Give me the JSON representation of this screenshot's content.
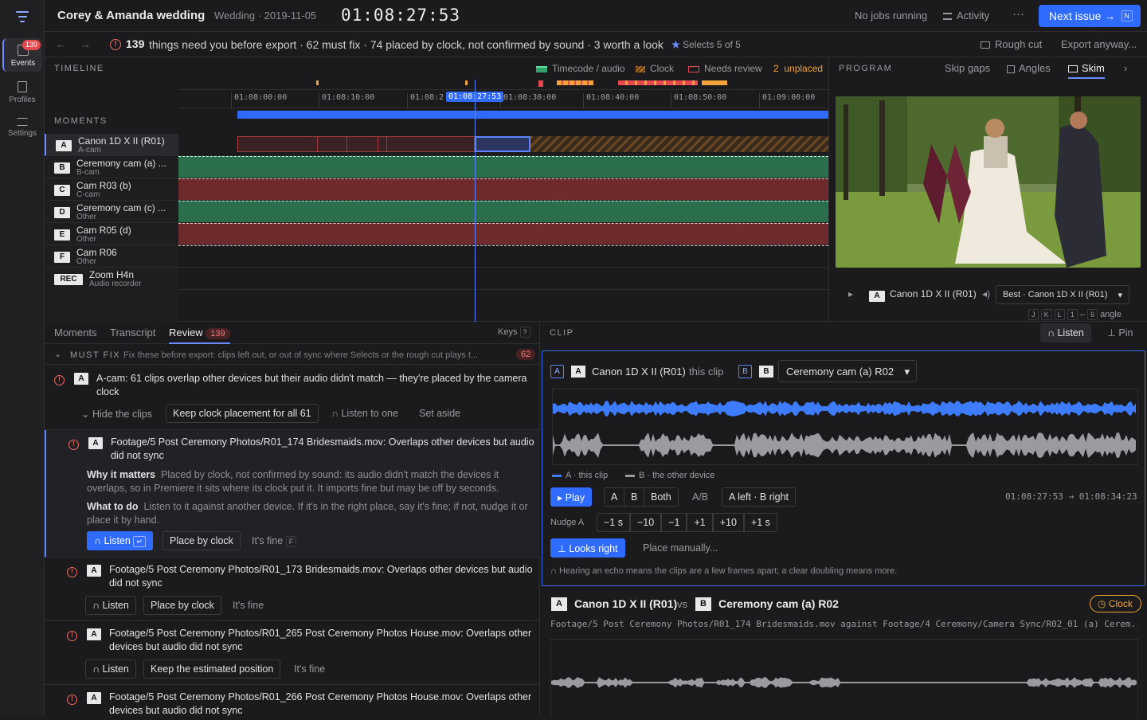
{
  "app": {
    "title": "Corey & Amanda wedding",
    "subtitle": "Wedding · 2019-11-05",
    "timecode": "01:08:27:53"
  },
  "rail": {
    "events_label": "Events",
    "events_badge": "139",
    "profiles_label": "Profiles",
    "settings_label": "Settings"
  },
  "topbar": {
    "jobs": "No jobs running",
    "activity": "Activity",
    "more": "···",
    "next_issue": "Next issue →",
    "next_key": "N"
  },
  "banner": {
    "count": "139",
    "message": "things need you before export · 62 must fix · 74 placed by clock, not confirmed by sound · 3 worth a look",
    "selects": "Selects",
    "selects_count": "5 of 5",
    "rough_cut": "Rough cut",
    "export_anyway": "Export anyway..."
  },
  "timeline": {
    "header": "TIMELINE",
    "legend": {
      "timecode_audio": "Timecode / audio",
      "clock": "Clock",
      "needs_review": "Needs review",
      "unplaced_count": "2",
      "unplaced": "unplaced"
    },
    "ticks": [
      "01:08:00:00",
      "01:08:10:00",
      "01:08:2",
      "01:08:30:00",
      "01:08:40:00",
      "01:08:50:00",
      "01:09:00:00"
    ],
    "playhead_label": "01:08:27:53",
    "moments_header": "MOMENTS",
    "tracks": [
      {
        "letter": "A",
        "name": "Canon 1D X II (R01)",
        "role": "A-cam"
      },
      {
        "letter": "B",
        "name": "Ceremony cam (a) ...",
        "role": "B-cam"
      },
      {
        "letter": "C",
        "name": "Cam R03 (b)",
        "role": "C-cam"
      },
      {
        "letter": "D",
        "name": "Ceremony cam (c) ...",
        "role": "Other"
      },
      {
        "letter": "E",
        "name": "Cam R05 (d)",
        "role": "Other"
      },
      {
        "letter": "F",
        "name": "Cam R06",
        "role": "Other"
      },
      {
        "letter": "REC",
        "name": "Zoom H4n",
        "role": "Audio recorder"
      }
    ]
  },
  "program": {
    "header": "PROGRAM",
    "skip_gaps": "Skip gaps",
    "angles": "Angles",
    "skim": "Skim",
    "clip_letter": "A",
    "clip_name": "Canon 1D X II (R01)",
    "best": "Best · Canon 1D X II (R01)",
    "keys": [
      "J",
      "K",
      "L",
      "1",
      "–",
      "6"
    ],
    "angle": "angle"
  },
  "review": {
    "tabs": {
      "moments": "Moments",
      "transcript": "Transcript",
      "review": "Review",
      "review_count": "139",
      "keys": "Keys",
      "keys_key": "?"
    },
    "must_fix": {
      "label": "MUST FIX",
      "desc": "Fix these before export: clips left out, or out of sync where Selects or the rough cut plays t...",
      "count": "62"
    },
    "group": {
      "letter": "A",
      "text": "A-cam: 61 clips overlap other devices but their audio didn't match — they're placed by the camera clock",
      "hide": "Hide the clips",
      "keep": "Keep clock placement for all 61",
      "listen_one": "Listen to one",
      "set_aside": "Set aside"
    },
    "items": [
      {
        "letter": "A",
        "text": "Footage/5 Post Ceremony Photos/R01_174 Bridesmaids.mov: Overlaps other devices but audio did not sync",
        "why_label": "Why it matters",
        "why": "Placed by clock, not confirmed by sound: its audio didn't match the devices it overlaps, so in Premiere it sits where its clock put it. It imports fine but may be off by seconds.",
        "what_label": "What to do",
        "what": "Listen to it against another device. If it's in the right place, say it's fine; if not, nudge it or place it by hand.",
        "listen": "Listen",
        "listen_key": "↵",
        "place": "Place by clock",
        "fine": "It's fine",
        "fine_key": "F"
      },
      {
        "letter": "A",
        "text": "Footage/5 Post Ceremony Photos/R01_173 Bridesmaids.mov: Overlaps other devices but audio did not sync",
        "listen": "Listen",
        "place": "Place by clock",
        "fine": "It's fine"
      },
      {
        "letter": "A",
        "text": "Footage/5 Post Ceremony Photos/R01_265 Post Ceremony Photos House.mov: Overlaps other devices but audio did not sync",
        "listen": "Listen",
        "place": "Keep the estimated position",
        "fine": "It's fine"
      },
      {
        "letter": "A",
        "text": "Footage/5 Post Ceremony Photos/R01_266 Post Ceremony Photos House.mov: Overlaps other devices but audio did not sync"
      }
    ]
  },
  "clip": {
    "header": "CLIP",
    "listen": "Listen",
    "pin": "Pin",
    "a_tag": "A",
    "a_letter": "A",
    "a_name": "Canon 1D X II (R01)",
    "this_clip": "this clip",
    "b_tag": "B",
    "b_letter": "B",
    "b_name": "Ceremony cam (a) R02",
    "legend_a": "A · this clip",
    "legend_b": "B · the other device",
    "play": "Play",
    "a": "A",
    "b": "B",
    "both": "Both",
    "ab": "A/B",
    "a_left_b_right": "A left · B right",
    "range": "01:08:27:53 → 01:08:34:23",
    "nudge_label": "Nudge A",
    "nudges": [
      "−1 s",
      "−10",
      "−1",
      "+1",
      "+10",
      "+1 s"
    ],
    "looks_right": "Looks right",
    "place_manually": "Place manually...",
    "hint": "Hearing an echo means the clips are a few frames apart; a clear doubling means more.",
    "compare": {
      "a_letter": "A",
      "a_name": "Canon 1D X II (R01)",
      "vs": "vs",
      "b_letter": "B",
      "b_name": "Ceremony cam (a) R02",
      "clock": "Clock",
      "path": "Footage/5 Post Ceremony Photos/R01_174 Bridesmaids.mov against Footage/4 Ceremony/Camera Sync/R02_01 (a) Cerem..."
    }
  },
  "colors": {
    "accent": "#2f6bff",
    "danger": "#e5484d",
    "clock": "#f2a33a",
    "synced": "#2fa36b"
  }
}
